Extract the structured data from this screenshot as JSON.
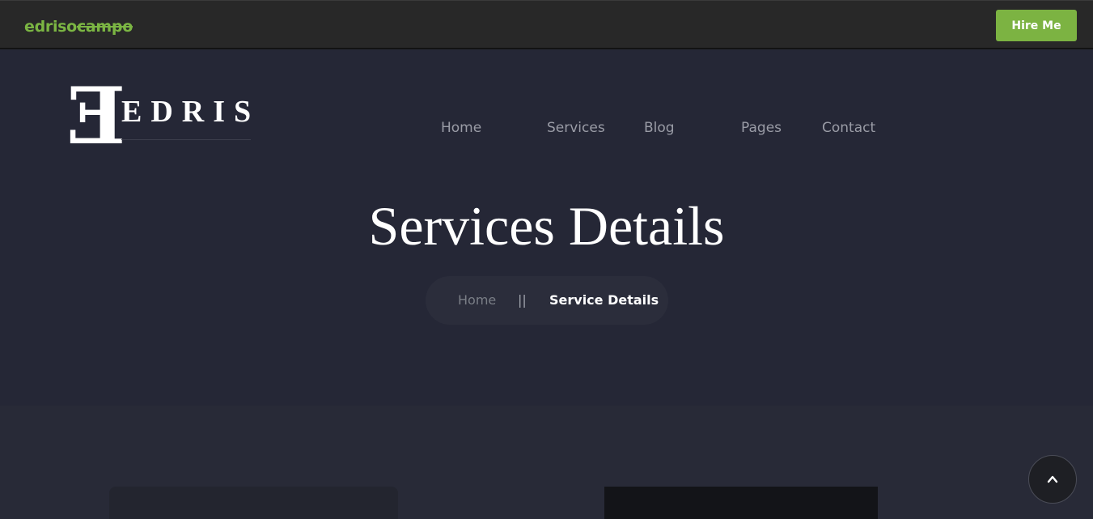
{
  "topbar": {
    "brand_plain": "edriso",
    "brand_struck": "campo",
    "hire_label": "Hire Me"
  },
  "logo": {
    "letter": "E",
    "text": "EDRIS"
  },
  "nav": {
    "items": [
      {
        "label": "Home"
      },
      {
        "label": "Services"
      },
      {
        "label": "Blog"
      },
      {
        "label": "Pages"
      },
      {
        "label": "Contact"
      }
    ]
  },
  "hero": {
    "title": "Services Details"
  },
  "breadcrumb": {
    "home": "Home",
    "separator": "||",
    "current": "Service Details"
  },
  "icons": {
    "back_to_top": "caret-up-icon"
  },
  "colors": {
    "accent": "#7cb342",
    "topbar_bg": "#282828",
    "hero_bg": "#252736",
    "body_bg": "#282a37"
  }
}
